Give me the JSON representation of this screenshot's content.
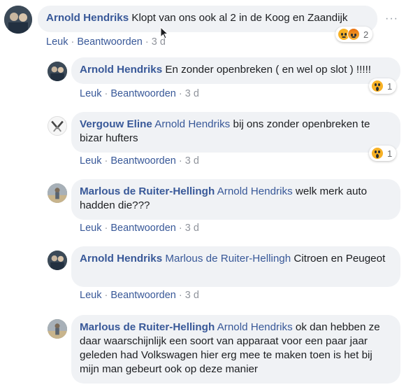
{
  "comments": [
    {
      "author": "Arnold Hendriks",
      "mention": "",
      "text": "Klopt van ons ook al 2 in de Koog en Zaandijk",
      "actions": {
        "like": "Leuk",
        "reply": "Beantwoorden",
        "sep": "·",
        "time": "3 d"
      },
      "reactions": {
        "types": [
          "sad-icon",
          "angry-icon"
        ],
        "count": "2"
      }
    },
    {
      "author": "Arnold Hendriks",
      "mention": "",
      "text": "En zonder openbreken ( en wel op slot ) !!!!!",
      "actions": {
        "like": "Leuk",
        "reply": "Beantwoorden",
        "sep": "·",
        "time": "3 d"
      },
      "reactions": {
        "types": [
          "wow-icon"
        ],
        "count": "1"
      }
    },
    {
      "author": "Vergouw Eline",
      "mention": "Arnold Hendriks",
      "text": "bij ons zonder openbreken te bizar hufters",
      "actions": {
        "like": "Leuk",
        "reply": "Beantwoorden",
        "sep": "·",
        "time": "3 d"
      },
      "reactions": {
        "types": [
          "wow-icon"
        ],
        "count": "1"
      }
    },
    {
      "author": "Marlous de Ruiter-Hellingh",
      "mention": "Arnold Hendriks",
      "text": "welk merk auto hadden die???",
      "actions": {
        "like": "Leuk",
        "reply": "Beantwoorden",
        "sep": "·",
        "time": "3 d"
      }
    },
    {
      "author": "Arnold Hendriks",
      "mention": "Marlous de Ruiter-Hellingh",
      "text": "Citroen en Peugeot",
      "actions": {
        "like": "Leuk",
        "reply": "Beantwoorden",
        "sep": "·",
        "time": "3 d"
      }
    },
    {
      "author": "Marlous de Ruiter-Hellingh",
      "mention": "Arnold Hendriks",
      "text": "ok dan hebben ze daar waarschijnlijk een soort van apparaat voor een paar jaar geleden had Volkswagen hier erg mee te maken toen is het bij mijn man gebeurt ook op deze manier",
      "actions": {}
    }
  ],
  "more_options": "···",
  "colors": {
    "link": "#385898",
    "bubble": "#f0f2f5",
    "meta": "#90949c"
  }
}
